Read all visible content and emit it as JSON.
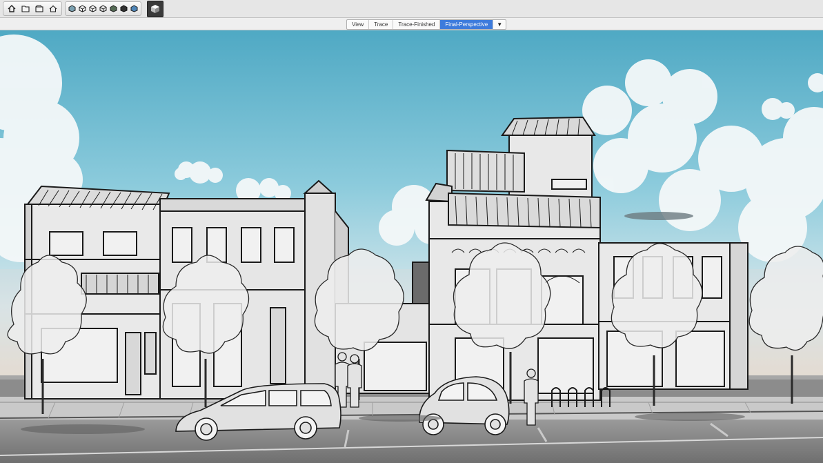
{
  "toolbar": {
    "buttons": [
      {
        "name": "home-icon"
      },
      {
        "name": "open-folder-icon"
      },
      {
        "name": "scene-icon"
      },
      {
        "name": "house-icon"
      },
      {
        "name": "view-iso-icon"
      },
      {
        "name": "view-top-icon"
      },
      {
        "name": "view-front-icon"
      },
      {
        "name": "view-right-icon"
      },
      {
        "name": "view-back-icon"
      },
      {
        "name": "view-left-icon"
      },
      {
        "name": "view-bottom-icon"
      },
      {
        "name": "style-icon"
      }
    ]
  },
  "scene_tabs": [
    {
      "label": "View",
      "active": false
    },
    {
      "label": "Trace",
      "active": false
    },
    {
      "label": "Trace-Finished",
      "active": false
    },
    {
      "label": "Final-Perspective",
      "active": true
    }
  ],
  "scene_tabs_menu": "▼",
  "colors": {
    "sky_top": "#4fa9c4",
    "sky_bottom": "#cde4ea",
    "active_tab": "#3d7bdc",
    "building_fill": "#e9e9e9",
    "road": "#7f7f7f"
  }
}
